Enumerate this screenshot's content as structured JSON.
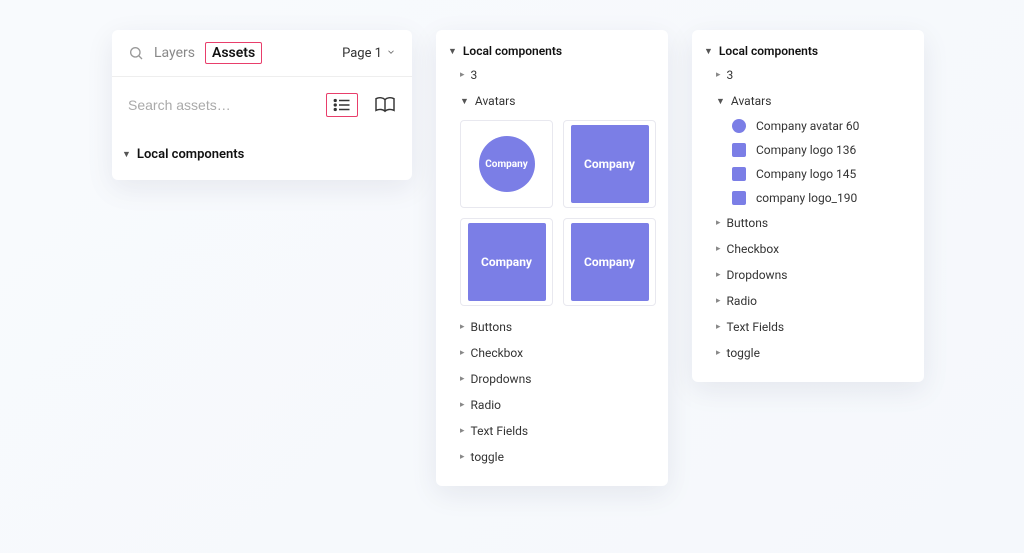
{
  "panel1": {
    "tab_layers": "Layers",
    "tab_assets": "Assets",
    "page_label": "Page 1",
    "search_placeholder": "Search assets…",
    "local_components": "Local components"
  },
  "panel2": {
    "local_components": "Local components",
    "group_3": "3",
    "avatars": "Avatars",
    "thumb_label": "Company",
    "folders": [
      "Buttons",
      "Checkbox",
      "Dropdowns",
      "Radio",
      "Text Fields",
      "toggle"
    ]
  },
  "panel3": {
    "local_components": "Local components",
    "group_3": "3",
    "avatars": "Avatars",
    "items": [
      {
        "shape": "circle",
        "label": "Company avatar 60"
      },
      {
        "shape": "square",
        "label": "Company logo 136"
      },
      {
        "shape": "square",
        "label": "Company logo 145"
      },
      {
        "shape": "square",
        "label": "company logo_190"
      }
    ],
    "folders": [
      "Buttons",
      "Checkbox",
      "Dropdowns",
      "Radio",
      "Text Fields",
      "toggle"
    ]
  }
}
